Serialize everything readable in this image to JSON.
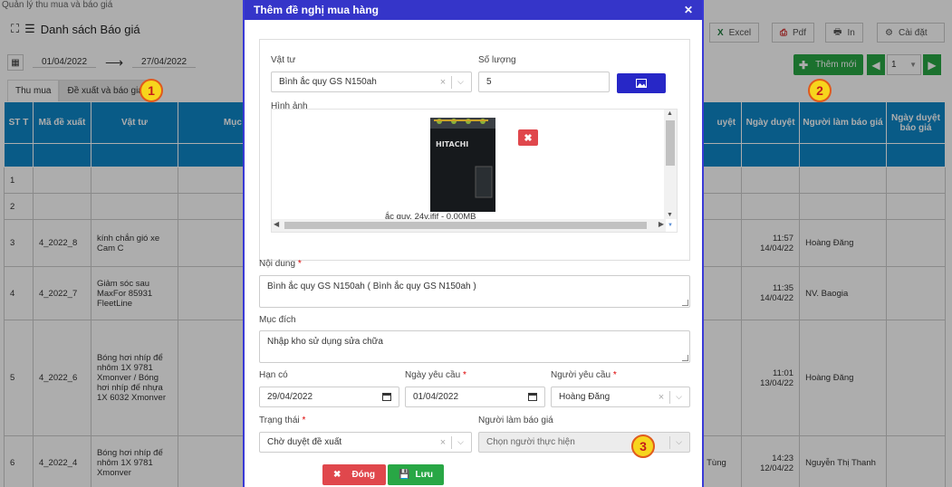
{
  "breadcrumb": "Quản lý thu mua và báo giá",
  "page": {
    "title": "Danh sách Báo giá",
    "toolbar": {
      "excel": "Excel",
      "pdf": "Pdf",
      "print": "In",
      "settings": "Cài đặt"
    },
    "date_from": "01/04/2022",
    "date_to": "27/04/2022",
    "new_button": "Thêm mới",
    "pager_value": "1",
    "tabs": [
      "Thu mua",
      "Đề xuất và báo giá"
    ],
    "columns": [
      "ST T",
      "Mã đề xuất",
      "Vật tư",
      "Mục",
      "uyệt",
      "Ngày duyệt",
      "Người làm báo giá",
      "Ngày duyệt báo giá"
    ],
    "rows": [
      {
        "stt": "1",
        "ma": "",
        "vattu": "",
        "ngay": "",
        "nguoi": "",
        "extra": ""
      },
      {
        "stt": "2",
        "ma": "",
        "vattu": "",
        "ngay": "",
        "nguoi": "",
        "extra": ""
      },
      {
        "stt": "3",
        "ma": "4_2022_8",
        "vattu": "kính chắn gió xe Cam C",
        "ngay": "11:57 14/04/22",
        "nguoi": "Hoàng Đăng",
        "extra": ""
      },
      {
        "stt": "4",
        "ma": "4_2022_7",
        "vattu": "Giảm sóc sau MaxFor 85931 FleetLine",
        "ngay": "11:35 14/04/22",
        "nguoi": "NV. Baogia",
        "extra": ""
      },
      {
        "stt": "5",
        "ma": "4_2022_6",
        "vattu": "Bóng hơi nhíp để nhôm 1X 9781 Xmonver / Bóng hơi nhíp đế nhựa 1X 6032 Xmonver",
        "ngay": "11:01 13/04/22",
        "nguoi": "Hoàng Đăng",
        "extra": ""
      },
      {
        "stt": "6",
        "ma": "4_2022_4",
        "vattu": "Bóng hơi nhíp đế nhôm 1X 9781 Xmonver",
        "ngay": "14:23 12/04/22",
        "nguoi": "Nguyễn Thị Thanh",
        "extra": "Tùng"
      }
    ]
  },
  "modal": {
    "title": "Thêm đề nghị mua hàng",
    "vat_tu_label": "Vật tư",
    "vat_tu_value": "Bình ắc quy GS N150ah",
    "so_luong_label": "Số lượng",
    "so_luong_value": "5",
    "hinh_anh_label": "Hình ảnh",
    "image_caption": "ắc quy. 24v.jfif - 0.00MB",
    "image_brand": "HITACHI",
    "noi_dung_label": "Nội dung",
    "noi_dung_value": "Bình ắc quy GS N150ah ( Bình ắc quy GS N150ah  )",
    "muc_dich_label": "Mục đích",
    "muc_dich_value": "Nhập kho sử dụng sửa chữa",
    "han_co_label": "Hạn có",
    "han_co_value": "29/04/2022",
    "ngay_yc_label": "Ngày yêu cầu",
    "ngay_yc_value": "01/04/2022",
    "nguoi_yc_label": "Người yêu cầu",
    "nguoi_yc_value": "Hoàng Đăng",
    "trang_thai_label": "Trạng thái",
    "trang_thai_value": "Chờ duyệt đề xuất",
    "nguoi_bg_label": "Người làm báo giá",
    "nguoi_bg_placeholder": "Chọn người thực hiện",
    "close_button": "Đóng",
    "save_button": "Lưu",
    "required_mark": "*"
  },
  "callouts": [
    "1",
    "2",
    "3"
  ],
  "colors": {
    "header_blue": "#3535c9",
    "table_blue": "#0e86c7",
    "green": "#28a745",
    "red": "#e0474c",
    "callout_fill": "#f7d51d"
  }
}
